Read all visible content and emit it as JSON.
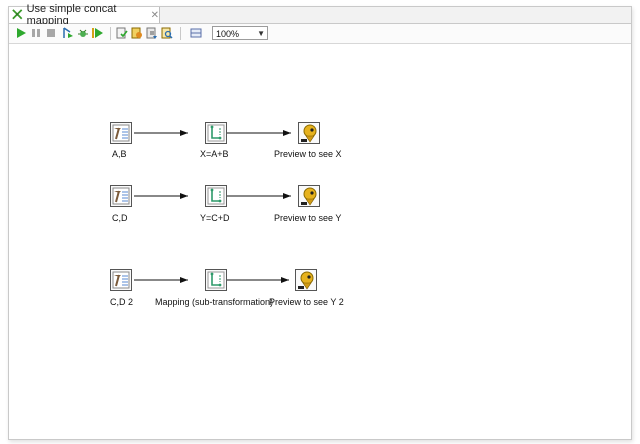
{
  "tab": {
    "title": "Use simple concat mapping",
    "icon": "transformation-icon",
    "close_icon": "close-icon"
  },
  "toolbar": {
    "icons": [
      "run-icon",
      "pause-icon",
      "stop-icon",
      "preview-icon",
      "debug-icon",
      "replay-icon",
      "verify-icon",
      "impact-icon",
      "sql-icon",
      "explore-db-icon",
      "grid-icon"
    ],
    "zoom": "100%"
  },
  "steps": [
    {
      "label": "A,B",
      "icon": "data-grid-icon"
    },
    {
      "label": "X=A+B",
      "icon": "mapping-icon"
    },
    {
      "label": "Preview to see X",
      "icon": "dummy-icon"
    },
    {
      "label": "C,D",
      "icon": "data-grid-icon"
    },
    {
      "label": "Y=C+D",
      "icon": "mapping-icon"
    },
    {
      "label": "Preview to see Y",
      "icon": "dummy-icon"
    },
    {
      "label": "C,D 2",
      "icon": "data-grid-icon"
    },
    {
      "label": "Mapping (sub-transformation)",
      "icon": "mapping-icon"
    },
    {
      "label": "Preview to see Y 2",
      "icon": "dummy-icon"
    }
  ]
}
